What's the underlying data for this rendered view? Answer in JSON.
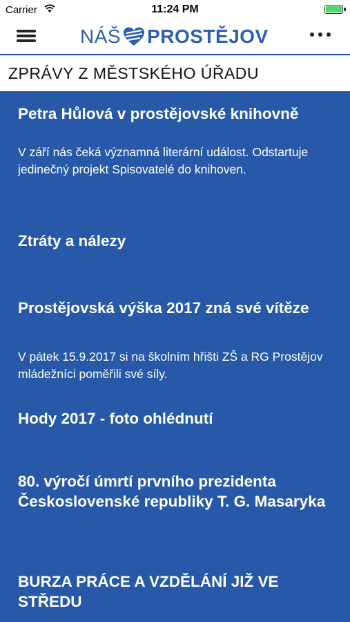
{
  "status_bar": {
    "carrier": "Carrier",
    "time": "11:24 PM",
    "battery_level": 1.0
  },
  "nav": {
    "logo_prefix": "NÁŠ",
    "logo_name": "PROSTĚJOV",
    "brand_color": "#2a5fb3",
    "menu_icon": "hamburger-menu-icon",
    "more_icon": "ellipsis-icon"
  },
  "section": {
    "title": "ZPRÁVY Z MĚSTSKÉHO ÚŘADU"
  },
  "news": [
    {
      "title": "Petra Hůlová v prostějovské knihovně",
      "description": "V září nás čeká významná literární událost. Odstartuje jedinečný projekt Spisovatelé do knihoven."
    },
    {
      "title": "Ztráty a nálezy",
      "description": ""
    },
    {
      "title": "Prostějovská výška 2017 zná své vítěze",
      "description": "V pátek 15.9.2017 si na školním hřišti ZŠ a RG Prostějov mládežníci poměřili své síly."
    },
    {
      "title": "Hody 2017 - foto ohlédnutí",
      "description": ""
    },
    {
      "title": "80. výročí úmrtí prvního prezidenta Československé republiky T. G. Masaryka",
      "description": ""
    },
    {
      "title": "BURZA PRÁCE A VZDĚLÁNÍ JIŽ VE STŘEDU",
      "description": ""
    }
  ],
  "colors": {
    "background": "#2759a8",
    "header_bg": "#ffffff"
  }
}
